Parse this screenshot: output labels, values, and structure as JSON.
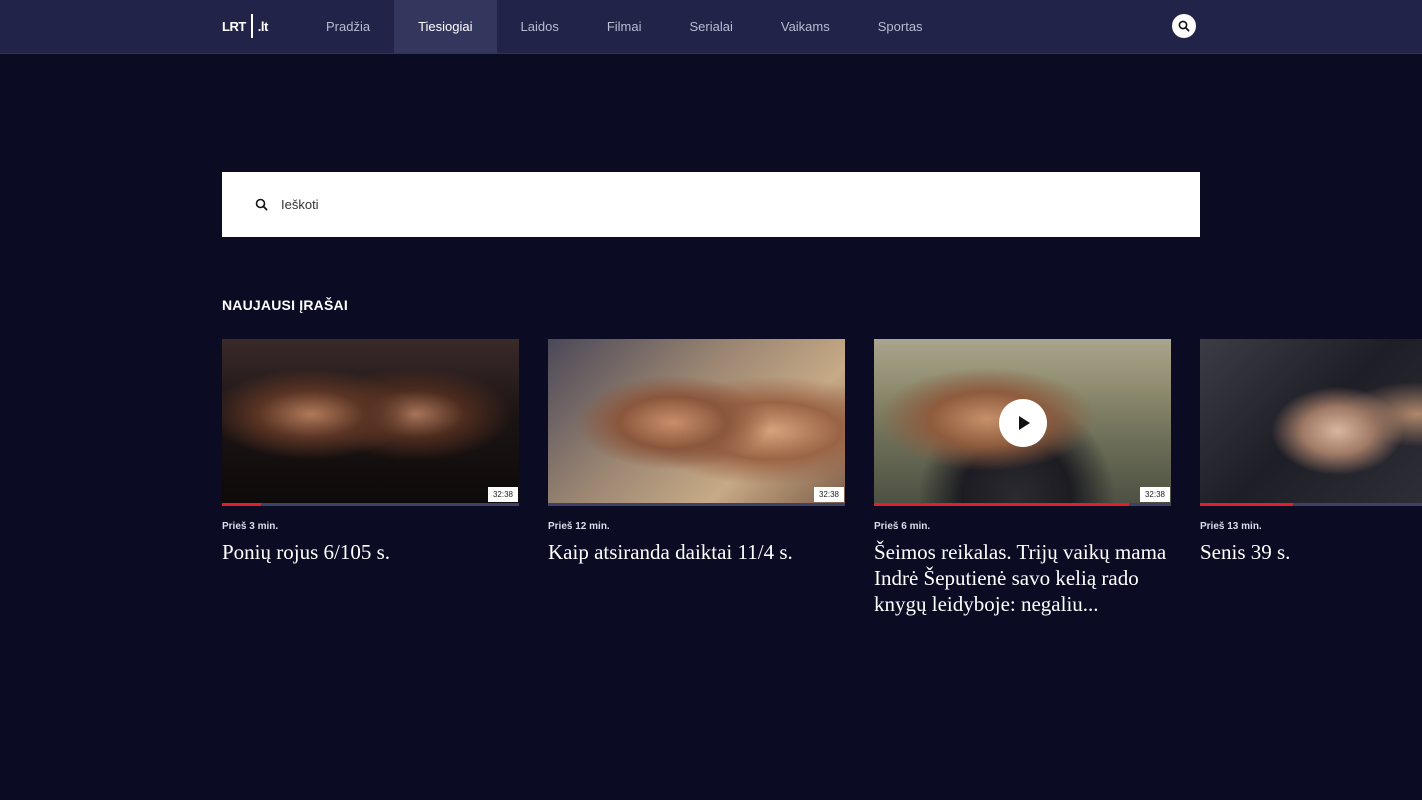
{
  "header": {
    "logo_left": "LRT",
    "logo_right": ".lt",
    "nav": [
      {
        "label": "Pradžia"
      },
      {
        "label": "Tiesiogiai",
        "active": true
      },
      {
        "label": "Laidos"
      },
      {
        "label": "Filmai"
      },
      {
        "label": "Serialai"
      },
      {
        "label": "Vaikams"
      },
      {
        "label": "Sportas"
      }
    ],
    "search_icon": "search-icon"
  },
  "search": {
    "placeholder": "Ieškoti",
    "value": ""
  },
  "section": {
    "title": "NAUJAUSI ĮRAŠAI"
  },
  "cards": [
    {
      "time_ago": "Prieš 3 min.",
      "title": "Ponių rojus 6/105 s.",
      "duration": "32:38",
      "progress": 0.13
    },
    {
      "time_ago": "Prieš 12 min.",
      "title": "Kaip atsiranda daiktai 11/4 s.",
      "duration": "32:38",
      "progress": 0.0
    },
    {
      "time_ago": "Prieš 6 min.",
      "title": "Šeimos reikalas. Trijų vaikų mama Indrė Šeputienė savo kelią rado knygų leidyboje: negaliu...",
      "duration": "32:38",
      "progress": 0.86,
      "show_play": true
    },
    {
      "time_ago": "Prieš 13 min.",
      "title": "Senis 39 s.",
      "duration": "",
      "progress": 0.42
    }
  ],
  "colors": {
    "background": "#0b0b24",
    "topbar": "#212448",
    "active_tab": "#33375e",
    "progress": "#e0202a"
  }
}
